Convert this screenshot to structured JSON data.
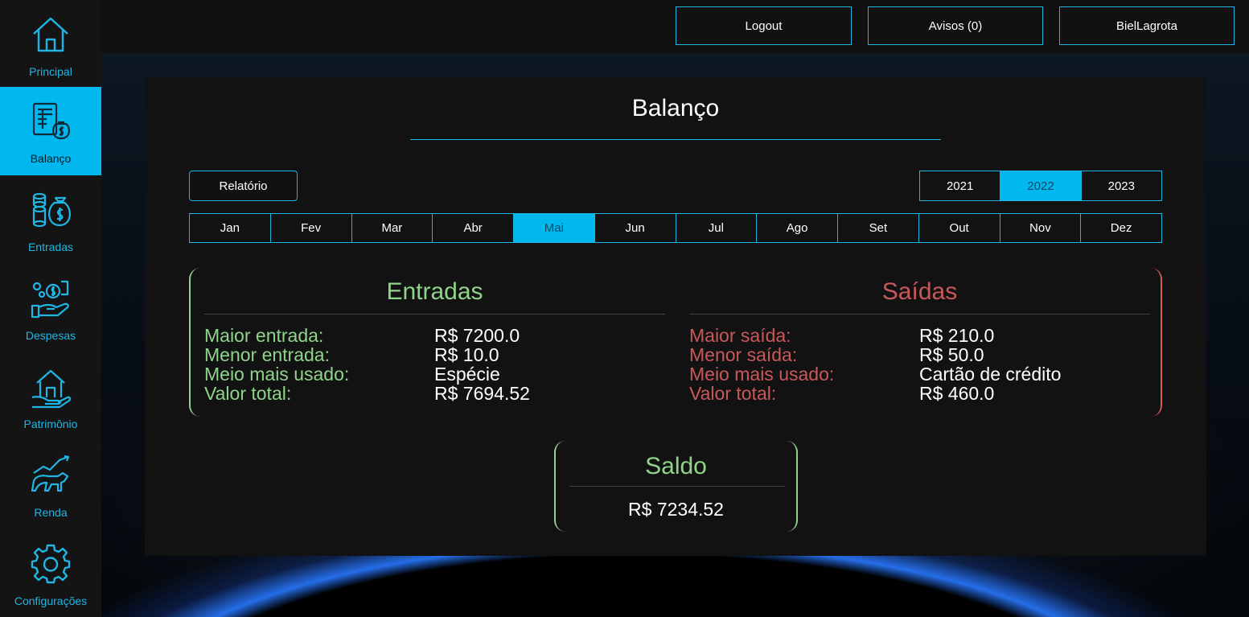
{
  "sidebar": {
    "items": [
      {
        "label": "Principal",
        "icon": "house-icon",
        "active": false
      },
      {
        "label": "Balanço",
        "icon": "spreadsheet-money-bag-icon",
        "active": true
      },
      {
        "label": "Entradas",
        "icon": "coins-money-bag-icon",
        "active": false
      },
      {
        "label": "Despesas",
        "icon": "hand-coins-icon",
        "active": false
      },
      {
        "label": "Patrimônio",
        "icon": "hand-house-icon",
        "active": false
      },
      {
        "label": "Renda",
        "icon": "bull-chart-icon",
        "active": false
      },
      {
        "label": "Configurações",
        "icon": "gear-icon",
        "active": false
      }
    ]
  },
  "topbar": {
    "logout_label": "Logout",
    "avisos_label": "Avisos (0)",
    "user_label": "BielLagrota"
  },
  "main": {
    "title": "Balanço",
    "report_label": "Relatório",
    "years": [
      "2021",
      "2022",
      "2023"
    ],
    "selected_year": "2022",
    "months": [
      "Jan",
      "Fev",
      "Mar",
      "Abr",
      "Mai",
      "Jun",
      "Jul",
      "Ago",
      "Set",
      "Out",
      "Nov",
      "Dez"
    ],
    "selected_month": "Mai",
    "entradas": {
      "title": "Entradas",
      "rows": [
        {
          "label": "Maior entrada:",
          "value": "R$ 7200.0"
        },
        {
          "label": "Menor entrada:",
          "value": "R$ 10.0"
        },
        {
          "label": "Meio mais usado:",
          "value": "Espécie"
        },
        {
          "label": "Valor total:",
          "value": "R$ 7694.52"
        }
      ]
    },
    "saidas": {
      "title": "Saídas",
      "rows": [
        {
          "label": "Maior saída:",
          "value": "R$ 210.0"
        },
        {
          "label": "Menor saída:",
          "value": "R$ 50.0"
        },
        {
          "label": "Meio mais usado:",
          "value": "Cartão de crédito"
        },
        {
          "label": "Valor total:",
          "value": "R$ 460.0"
        }
      ]
    },
    "saldo": {
      "title": "Saldo",
      "value": "R$ 7234.52"
    }
  },
  "colors": {
    "accent": "#00b7ee",
    "positive": "#8fd48a",
    "negative": "#c9585a"
  }
}
